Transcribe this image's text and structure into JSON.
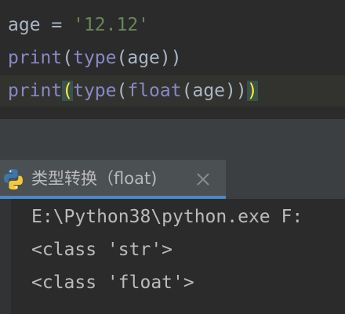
{
  "editor": {
    "line1": {
      "var": "age",
      "op": " = ",
      "str": "'12.12'"
    },
    "line2": {
      "fn": "print",
      "open1": "(",
      "fn2": "type",
      "open2": "(",
      "arg": "age",
      "close": "))"
    },
    "line3": {
      "fn": "print",
      "open1": "(",
      "fn2": "type",
      "open2": "(",
      "fn3": "float",
      "open3": "(",
      "arg": "age",
      "close2": "))",
      "close1": ")"
    }
  },
  "run_panel": {
    "tab_label": "类型转换（float)",
    "icon": "python-icon",
    "close_icon": "close-icon"
  },
  "console": {
    "lines": [
      "E:\\Python38\\python.exe F:",
      "<class 'str'>",
      "<class 'float'>"
    ]
  },
  "colors": {
    "background": "#2b2b2b",
    "keyword": "#8888c6",
    "string": "#6a8759",
    "text": "#a9b7c6",
    "brace_highlight": "#ffef28",
    "tab_underline": "#4a88c7"
  }
}
